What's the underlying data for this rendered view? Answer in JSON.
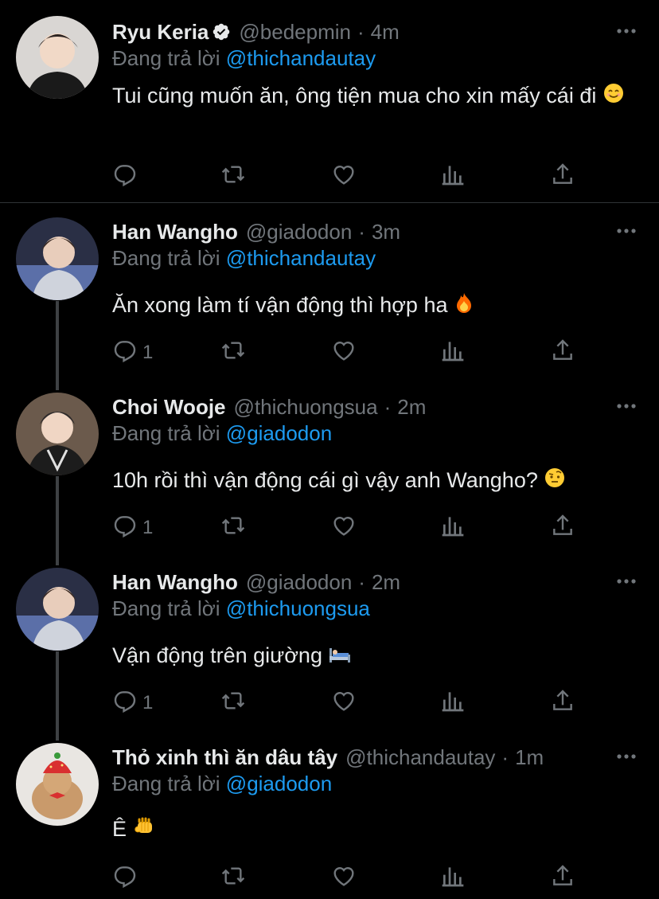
{
  "tweets": [
    {
      "name": "Ryu Keria",
      "verified": true,
      "handle": "@bedepmin",
      "sep": "·",
      "time": "4m",
      "reply_prefix": "Đang trả lời",
      "reply_to": "@thichandautay",
      "text": "Tui cũng muốn ăn, ông tiện mua cho xin mấy cái đi",
      "emoji": "smiling-face",
      "reply_count": ""
    },
    {
      "name": "Han Wangho",
      "verified": false,
      "handle": "@giadodon",
      "sep": "·",
      "time": "3m",
      "reply_prefix": "Đang trả lời",
      "reply_to": "@thichandautay",
      "text": "Ăn xong làm tí vận động thì hợp ha",
      "emoji": "fire",
      "reply_count": "1"
    },
    {
      "name": "Choi Wooje",
      "verified": false,
      "handle": "@thichuongsua",
      "sep": "·",
      "time": "2m",
      "reply_prefix": "Đang trả lời",
      "reply_to": "@giadodon",
      "text": "10h rồi thì vận động cái gì vậy anh Wangho?",
      "emoji": "raised-eyebrow-face",
      "reply_count": "1"
    },
    {
      "name": "Han Wangho",
      "verified": false,
      "handle": "@giadodon",
      "sep": "·",
      "time": "2m",
      "reply_prefix": "Đang trả lời",
      "reply_to": "@thichuongsua",
      "text": "Vận động trên giường",
      "emoji": "bed",
      "reply_count": "1"
    },
    {
      "name": "Thỏ xinh thì ăn dâu tây",
      "verified": false,
      "handle": "@thichandautay",
      "sep": "·",
      "time": "1m",
      "reply_prefix": "Đang trả lời",
      "reply_to": "@giadodon",
      "text": "Ê",
      "emoji": "fist-bump",
      "reply_count": ""
    }
  ],
  "colors": {
    "background": "#000000",
    "text": "#e7e9ea",
    "muted": "#71767b",
    "link": "#1d9bf0",
    "verified": "#e7e9ea"
  },
  "icons": [
    "reply-icon",
    "retweet-icon",
    "like-icon",
    "analytics-icon",
    "share-icon",
    "more-icon"
  ]
}
